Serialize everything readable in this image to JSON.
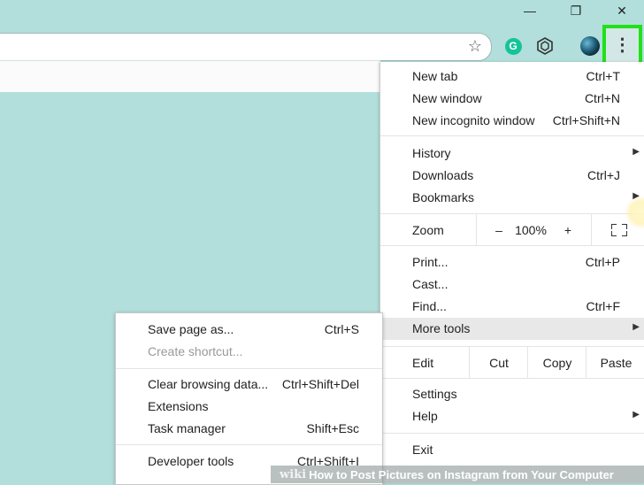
{
  "window": {
    "minimize_glyph": "—",
    "restore_glyph": "❐",
    "close_glyph": "✕"
  },
  "toolbar": {
    "star_icon": "star-icon",
    "grammarly_letter": "G",
    "menu_glyph": "⋮"
  },
  "menu": {
    "new_tab": {
      "label": "New tab",
      "shortcut": "Ctrl+T"
    },
    "new_window": {
      "label": "New window",
      "shortcut": "Ctrl+N"
    },
    "new_incognito": {
      "label": "New incognito window",
      "shortcut": "Ctrl+Shift+N"
    },
    "history": {
      "label": "History"
    },
    "downloads": {
      "label": "Downloads",
      "shortcut": "Ctrl+J"
    },
    "bookmarks": {
      "label": "Bookmarks"
    },
    "zoom": {
      "label": "Zoom",
      "minus": "–",
      "value": "100%",
      "plus": "+"
    },
    "print": {
      "label": "Print...",
      "shortcut": "Ctrl+P"
    },
    "cast": {
      "label": "Cast..."
    },
    "find": {
      "label": "Find...",
      "shortcut": "Ctrl+F"
    },
    "more_tools": {
      "label": "More tools"
    },
    "edit": {
      "label": "Edit",
      "cut": "Cut",
      "copy": "Copy",
      "paste": "Paste"
    },
    "settings": {
      "label": "Settings"
    },
    "help": {
      "label": "Help"
    },
    "exit": {
      "label": "Exit"
    },
    "arrow_glyph": "▶"
  },
  "submenu": {
    "save_page": {
      "label": "Save page as...",
      "shortcut": "Ctrl+S"
    },
    "create_shortcut": {
      "label": "Create shortcut..."
    },
    "clear_browsing": {
      "label": "Clear browsing data...",
      "shortcut": "Ctrl+Shift+Del"
    },
    "extensions": {
      "label": "Extensions"
    },
    "task_manager": {
      "label": "Task manager",
      "shortcut": "Shift+Esc"
    },
    "developer_tools": {
      "label": "Developer tools",
      "shortcut": "Ctrl+Shift+I"
    }
  },
  "watermark": {
    "wiki": "wiki",
    "text": "How to Post Pictures on Instagram from Your Computer"
  },
  "colors": {
    "page_bg": "#b2dfdb",
    "highlight_border": "#22e01a",
    "grammarly": "#15c39a"
  }
}
